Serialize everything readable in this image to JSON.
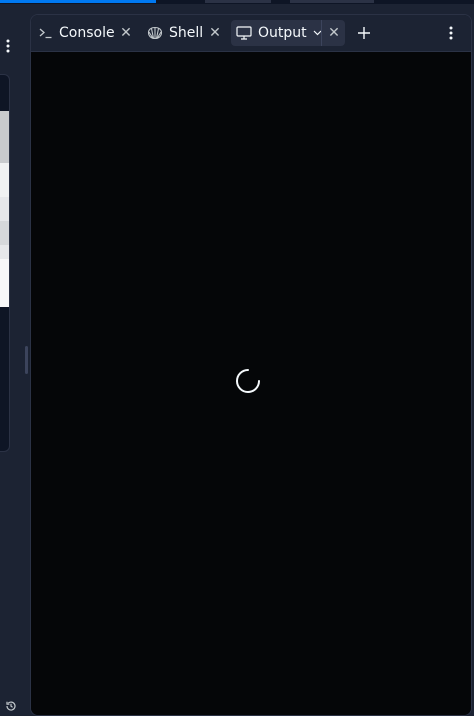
{
  "tabs": [
    {
      "label": "Console",
      "icon": "terminal-prompt-icon",
      "active": false
    },
    {
      "label": "Shell",
      "icon": "shell-icon",
      "active": false
    },
    {
      "label": "Output",
      "icon": "monitor-icon",
      "active": true
    }
  ],
  "colors": {
    "background": "#1c2333",
    "panel": "#0e1525",
    "border": "#2b3245",
    "output_background": "#050608",
    "accent": "#0079f2",
    "text": "#f5f9fc",
    "muted": "#c2c8cc"
  },
  "output": {
    "state": "loading",
    "indicator": "spinner-icon"
  }
}
